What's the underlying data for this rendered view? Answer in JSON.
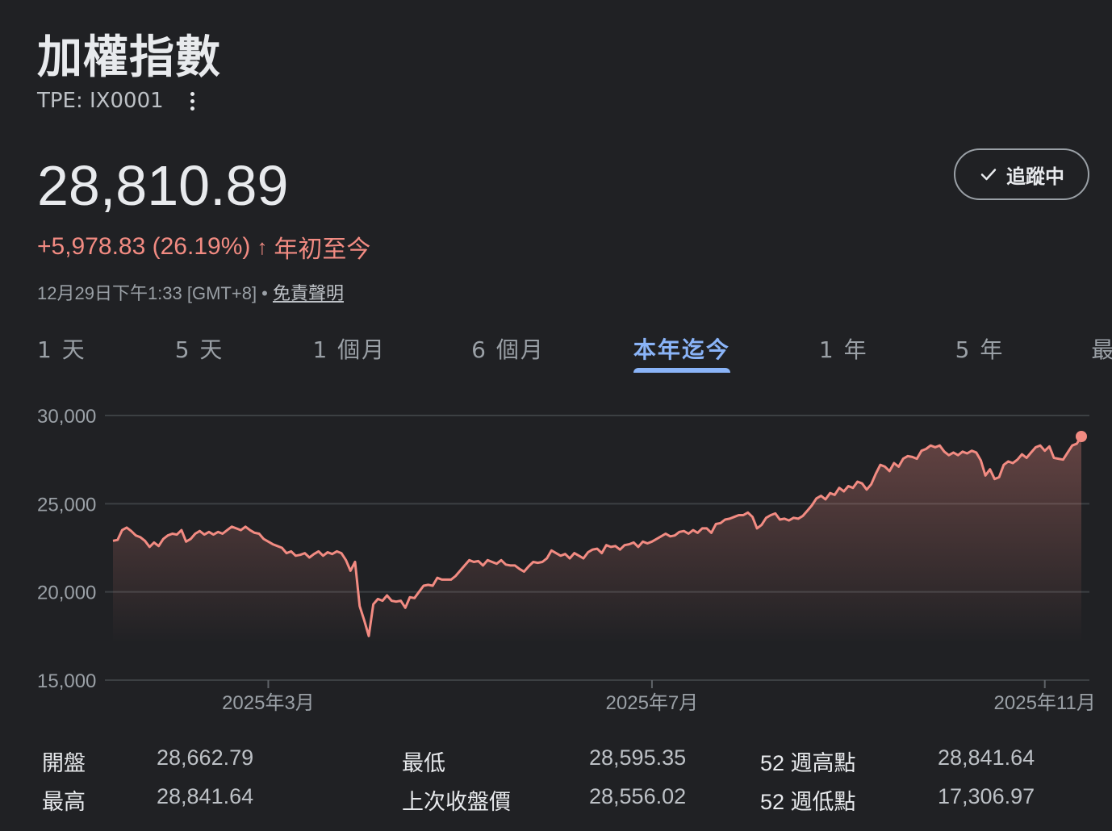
{
  "header": {
    "title": "加權指數",
    "ticker": "TPE: IX0001",
    "price": "28,810.89",
    "change": "+5,978.83 (26.19%)",
    "change_arrow": "↑",
    "change_period": "年初至今",
    "timestamp": "12月29日下午1:33 [GMT+8] •",
    "disclaimer": "免責聲明",
    "follow_label": "追蹤中"
  },
  "tabs": [
    {
      "label": "1 天",
      "active": false
    },
    {
      "label": "5 天",
      "active": false
    },
    {
      "label": "1 個月",
      "active": false
    },
    {
      "label": "6 個月",
      "active": false
    },
    {
      "label": "本年迄今",
      "active": true
    },
    {
      "label": "1 年",
      "active": false
    },
    {
      "label": "5 年",
      "active": false
    },
    {
      "label": "最久",
      "active": false
    }
  ],
  "colors": {
    "background": "#202124",
    "line": "#f28b82",
    "accent": "#8ab4f8",
    "grid": "#3c4043"
  },
  "chart_data": {
    "type": "area",
    "y_ticks": [
      "30,000",
      "25,000",
      "20,000",
      "15,000"
    ],
    "y_tick_values": [
      30000,
      25000,
      20000,
      15000
    ],
    "ylim": [
      15000,
      30000
    ],
    "x_ticks": [
      "2025年3月",
      "2025年7月",
      "2025年11月"
    ],
    "x_tick_index": [
      34,
      118,
      204
    ],
    "last_point_marker": true,
    "series": [
      {
        "values": [
          22900,
          22950,
          23500,
          23650,
          23450,
          23200,
          23100,
          22900,
          22550,
          22800,
          22600,
          23000,
          23200,
          23300,
          23250,
          23500,
          22850,
          23000,
          23300,
          23450,
          23250,
          23400,
          23250,
          23400,
          23300,
          23500,
          23700,
          23600,
          23500,
          23700,
          23500,
          23350,
          23300,
          23000,
          22850,
          22700,
          22600,
          22500,
          22200,
          22300,
          22050,
          22100,
          22200,
          21950,
          22150,
          22300,
          22050,
          22250,
          22150,
          22300,
          22200,
          21800,
          21200,
          21700,
          19200,
          18400,
          17500,
          19300,
          19600,
          19500,
          19800,
          19500,
          19450,
          19500,
          19100,
          19700,
          19650,
          20000,
          20350,
          20400,
          20350,
          20800,
          20700,
          20700,
          20700,
          20900,
          21200,
          21500,
          21800,
          21700,
          21750,
          21500,
          21800,
          21700,
          21600,
          21800,
          21550,
          21500,
          21500,
          21300,
          21150,
          21450,
          21700,
          21650,
          21700,
          21900,
          22350,
          22200,
          22050,
          22150,
          21900,
          22200,
          22050,
          21900,
          22250,
          22400,
          22450,
          22200,
          22650,
          22550,
          22600,
          22400,
          22650,
          22700,
          22800,
          22550,
          22850,
          22750,
          22850,
          23000,
          23150,
          23300,
          23150,
          23200,
          23400,
          23450,
          23300,
          23500,
          23350,
          23600,
          23600,
          23350,
          23850,
          23900,
          24100,
          24150,
          24250,
          24350,
          24350,
          24500,
          24250,
          23600,
          23800,
          24200,
          24350,
          24450,
          24100,
          24150,
          24050,
          24200,
          24150,
          24300,
          24600,
          24900,
          25300,
          25450,
          25250,
          25600,
          25500,
          25900,
          25700,
          26000,
          25900,
          26250,
          26150,
          25800,
          26100,
          26700,
          27200,
          27100,
          26850,
          27300,
          27100,
          27550,
          27700,
          27650,
          27550,
          28000,
          28100,
          28300,
          28200,
          28300,
          27950,
          27750,
          27900,
          27750,
          27950,
          27850,
          28000,
          27900,
          27450,
          26600,
          26950,
          26400,
          26500,
          27200,
          27400,
          27300,
          27500,
          27800,
          27600,
          27900,
          28200,
          28300,
          28000,
          28250,
          27600,
          27550,
          27500,
          27900,
          28300,
          28400,
          28811
        ]
      }
    ]
  },
  "stats": {
    "rows": [
      [
        {
          "label": "開盤",
          "value": "28,662.79"
        },
        {
          "label": "最低",
          "value": "28,595.35"
        },
        {
          "label": "52 週高點",
          "value": "28,841.64"
        }
      ],
      [
        {
          "label": "最高",
          "value": "28,841.64"
        },
        {
          "label": "上次收盤價",
          "value": "28,556.02"
        },
        {
          "label": "52 週低點",
          "value": "17,306.97"
        }
      ]
    ]
  }
}
